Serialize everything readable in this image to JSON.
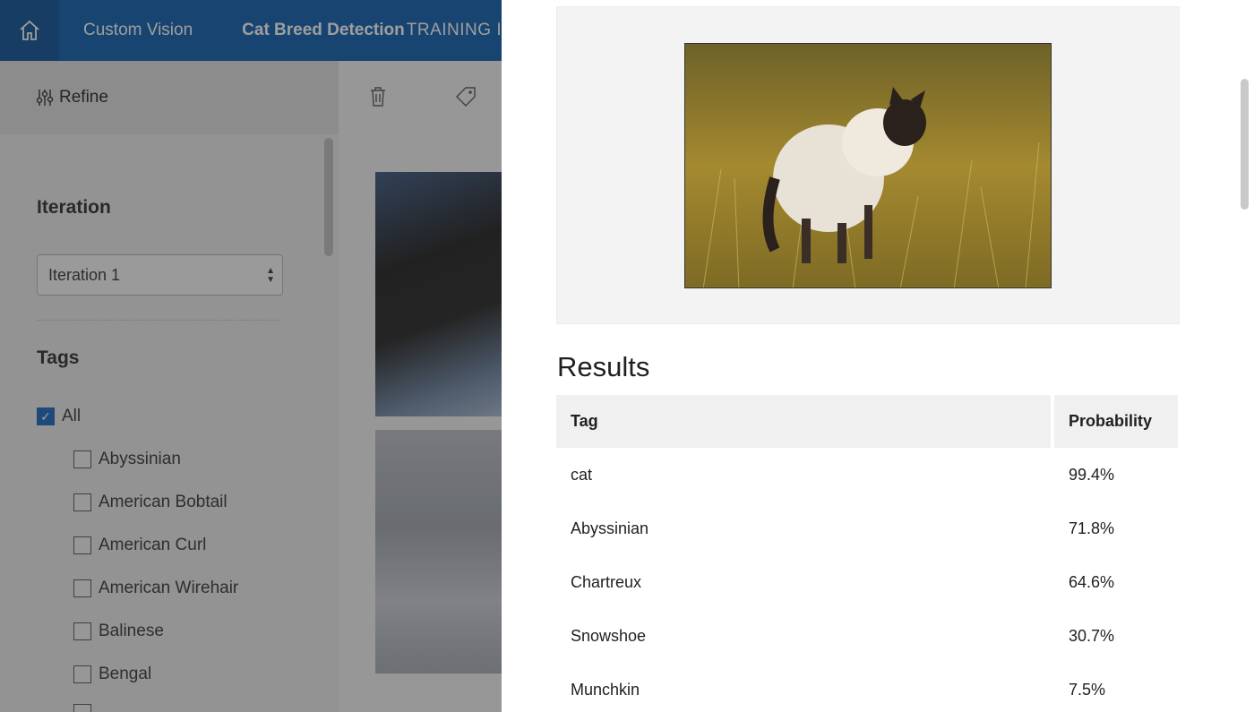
{
  "header": {
    "app_name": "Custom Vision",
    "project_name": "Cat Breed Detection",
    "section_name": "TRAINING IMA"
  },
  "toolbar": {
    "refine_label": "Refine"
  },
  "filters": {
    "iteration_heading": "Iteration",
    "iteration_selected": "Iteration 1",
    "tags_heading": "Tags",
    "all_label": "All",
    "tags": [
      "Abyssinian",
      "American Bobtail",
      "American Curl",
      "American Wirehair",
      "Balinese",
      "Bengal"
    ]
  },
  "results": {
    "heading": "Results",
    "columns": [
      "Tag",
      "Probability"
    ],
    "rows": [
      {
        "tag": "cat",
        "probability": "99.4%"
      },
      {
        "tag": "Abyssinian",
        "probability": "71.8%"
      },
      {
        "tag": "Chartreux",
        "probability": "64.6%"
      },
      {
        "tag": "Snowshoe",
        "probability": "30.7%"
      },
      {
        "tag": "Munchkin",
        "probability": "7.5%"
      }
    ]
  },
  "colors": {
    "header_blue": "#0b5cad",
    "checkbox_blue": "#1566c0",
    "panel_bg": "#ffffff"
  }
}
